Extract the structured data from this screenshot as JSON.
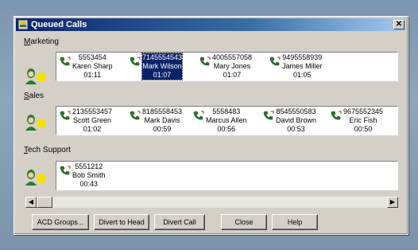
{
  "window": {
    "title": "Queued Calls"
  },
  "sections": [
    {
      "label": "Marketing",
      "calls": [
        {
          "number": "5553454",
          "name": "Karen Sharp",
          "time": "01:11"
        },
        {
          "number": "7145554543",
          "name": "Mark Wilson",
          "time": "01:07",
          "selected": true
        },
        {
          "number": "4005557058",
          "name": "Mary Jones",
          "time": "01:07"
        },
        {
          "number": "9495558939",
          "name": "James Miller",
          "time": "01:05"
        }
      ]
    },
    {
      "label": "Sales",
      "calls": [
        {
          "number": "2135553457",
          "name": "Scott Green",
          "time": "01:02"
        },
        {
          "number": "8185558453",
          "name": "Mark Davis",
          "time": "00:59"
        },
        {
          "number": "5558483",
          "name": "Marcus Allen",
          "time": "00:56"
        },
        {
          "number": "8545550583",
          "name": "David Brown",
          "time": "00:53"
        },
        {
          "number": "9675552345",
          "name": "Eric Fish",
          "time": "00:50"
        }
      ]
    },
    {
      "label": "Tech Support",
      "calls": [
        {
          "number": "5551212",
          "name": "Bob Smith",
          "time": "00:43"
        }
      ]
    }
  ],
  "buttons": {
    "acd_groups": "ACD Groups...",
    "divert_to_head": "Divert to Head",
    "divert_call": "Divert Call",
    "close": "Close",
    "help": "Help"
  },
  "icons": {
    "title_icon": "queue-icon",
    "agent_icon": "agent-person-icon",
    "call_icon": "phone-call-icon",
    "close_icon": "close-icon"
  },
  "colors": {
    "titlebar": "#0a246a",
    "selection": "#0a246a",
    "agent_status": "#f5e000"
  }
}
